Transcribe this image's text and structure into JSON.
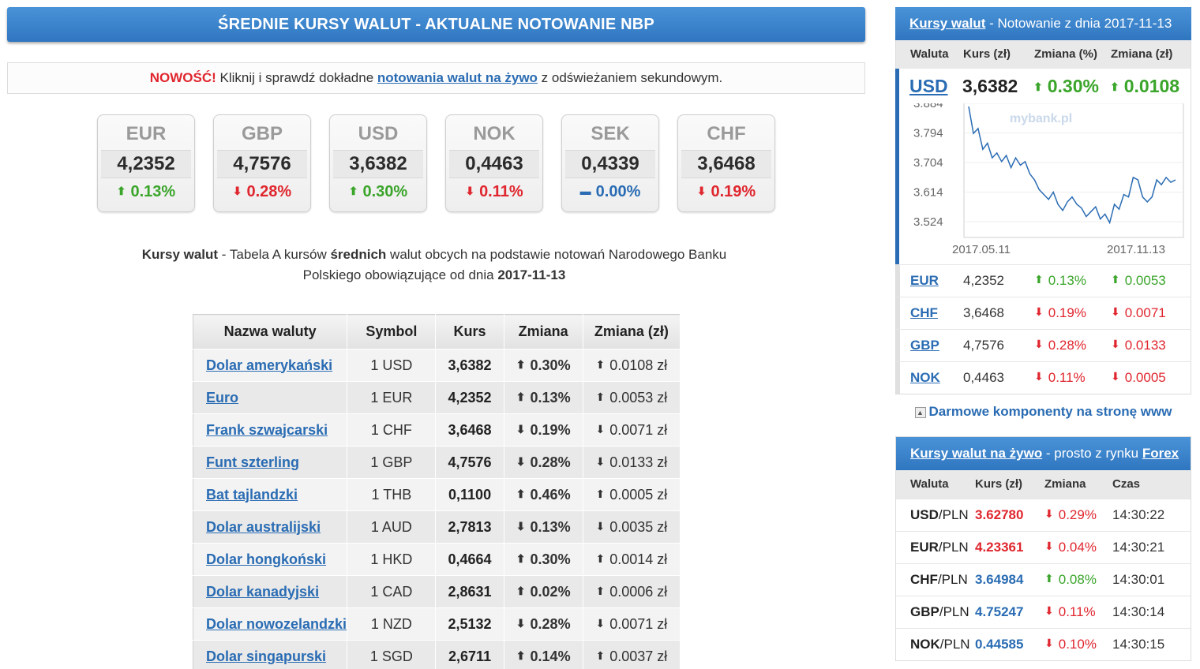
{
  "banner": {
    "title": "ŚREDNIE KURSY WALUT - AKTUALNE NOTOWANIE NBP"
  },
  "news": {
    "label": "NOWOŚĆ!",
    "text_before": " Kliknij i sprawdź dokładne ",
    "link": "notowania walut na żywo",
    "text_after": " z odświeżaniem sekundowym."
  },
  "tiles": [
    {
      "code": "EUR",
      "rate": "4,2352",
      "change": "0.13%",
      "dir": "up"
    },
    {
      "code": "GBP",
      "rate": "4,7576",
      "change": "0.28%",
      "dir": "down"
    },
    {
      "code": "USD",
      "rate": "3,6382",
      "change": "0.30%",
      "dir": "up"
    },
    {
      "code": "NOK",
      "rate": "0,4463",
      "change": "0.11%",
      "dir": "down"
    },
    {
      "code": "SEK",
      "rate": "0,4339",
      "change": "0.00%",
      "dir": "flat"
    },
    {
      "code": "CHF",
      "rate": "3,6468",
      "change": "0.19%",
      "dir": "down"
    }
  ],
  "desc": {
    "b1": "Kursy walut",
    "t1": " - Tabela A kursów ",
    "b2": "średnich",
    "t2": " walut obcych na podstawie notowań Narodowego Banku Polskiego obowiązujące od dnia ",
    "date": "2017-11-13"
  },
  "table": {
    "headers": [
      "Nazwa waluty",
      "Symbol",
      "Kurs",
      "Zmiana",
      "Zmiana (zł)"
    ],
    "rows": [
      {
        "name": "Dolar amerykański",
        "symbol": "1 USD",
        "kurs": "3,6382",
        "pct": "0.30%",
        "zl": "0.0108 zł",
        "dir": "up"
      },
      {
        "name": "Euro",
        "symbol": "1 EUR",
        "kurs": "4,2352",
        "pct": "0.13%",
        "zl": "0.0053 zł",
        "dir": "up"
      },
      {
        "name": "Frank szwajcarski",
        "symbol": "1 CHF",
        "kurs": "3,6468",
        "pct": "0.19%",
        "zl": "0.0071 zł",
        "dir": "down"
      },
      {
        "name": "Funt szterling",
        "symbol": "1 GBP",
        "kurs": "4,7576",
        "pct": "0.28%",
        "zl": "0.0133 zł",
        "dir": "down"
      },
      {
        "name": "Bat tajlandzki",
        "symbol": "1 THB",
        "kurs": "0,1100",
        "pct": "0.46%",
        "zl": "0.0005 zł",
        "dir": "up"
      },
      {
        "name": "Dolar australijski",
        "symbol": "1 AUD",
        "kurs": "2,7813",
        "pct": "0.13%",
        "zl": "0.0035 zł",
        "dir": "down"
      },
      {
        "name": "Dolar hongkoński",
        "symbol": "1 HKD",
        "kurs": "0,4664",
        "pct": "0.30%",
        "zl": "0.0014 zł",
        "dir": "up"
      },
      {
        "name": "Dolar kanadyjski",
        "symbol": "1 CAD",
        "kurs": "2,8631",
        "pct": "0.02%",
        "zl": "0.0006 zł",
        "dir": "up"
      },
      {
        "name": "Dolar nowozelandzki",
        "symbol": "1 NZD",
        "kurs": "2,5132",
        "pct": "0.28%",
        "zl": "0.0071 zł",
        "dir": "down"
      },
      {
        "name": "Dolar singapurski",
        "symbol": "1 SGD",
        "kurs": "2,6711",
        "pct": "0.14%",
        "zl": "0.0037 zł",
        "dir": "up"
      }
    ]
  },
  "side": {
    "head_link": "Kursy walut",
    "head_text": " - Notowanie z dnia 2017-11-13",
    "cols": [
      "Waluta",
      "Kurs (zł)",
      "Zmiana (%)",
      "Zmiana (zł)"
    ],
    "featured": {
      "code": "USD",
      "rate": "3,6382",
      "pct": "0.30%",
      "zl": "0.0108",
      "dir": "up"
    },
    "chart": {
      "watermark": "mybank.pl",
      "y_ticks": [
        "3.884",
        "3.794",
        "3.704",
        "3.614",
        "3.524"
      ],
      "x_ticks": [
        "2017.05.11",
        "2017.11.13"
      ]
    },
    "rows": [
      {
        "code": "EUR",
        "rate": "4,2352",
        "pct": "0.13%",
        "zl": "0.0053",
        "dir": "up"
      },
      {
        "code": "CHF",
        "rate": "3,6468",
        "pct": "0.19%",
        "zl": "0.0071",
        "dir": "down"
      },
      {
        "code": "GBP",
        "rate": "4,7576",
        "pct": "0.28%",
        "zl": "0.0133",
        "dir": "down"
      },
      {
        "code": "NOK",
        "rate": "0,4463",
        "pct": "0.11%",
        "zl": "0.0005",
        "dir": "down"
      }
    ],
    "widget_link": "Darmowe komponenty na stronę www"
  },
  "live": {
    "head_link": "Kursy walut na żywo",
    "head_text": " - prosto z rynku ",
    "head_link2": "Forex",
    "cols": [
      "Waluta",
      "Kurs (zł)",
      "Zmiana",
      "Czas"
    ],
    "rows": [
      {
        "base": "USD",
        "quote": "/PLN",
        "rate": "3.62780",
        "rate_dir": "down",
        "chg": "0.29%",
        "chg_dir": "down",
        "time": "14:30:22"
      },
      {
        "base": "EUR",
        "quote": "/PLN",
        "rate": "4.23361",
        "rate_dir": "down",
        "chg": "0.04%",
        "chg_dir": "down",
        "time": "14:30:21"
      },
      {
        "base": "CHF",
        "quote": "/PLN",
        "rate": "3.64984",
        "rate_dir": "up",
        "chg": "0.08%",
        "chg_dir": "up",
        "time": "14:30:01"
      },
      {
        "base": "GBP",
        "quote": "/PLN",
        "rate": "4.75247",
        "rate_dir": "up",
        "chg": "0.11%",
        "chg_dir": "down",
        "time": "14:30:14"
      },
      {
        "base": "NOK",
        "quote": "/PLN",
        "rate": "0.44585",
        "rate_dir": "up",
        "chg": "0.10%",
        "chg_dir": "down",
        "time": "14:30:15"
      }
    ]
  }
}
